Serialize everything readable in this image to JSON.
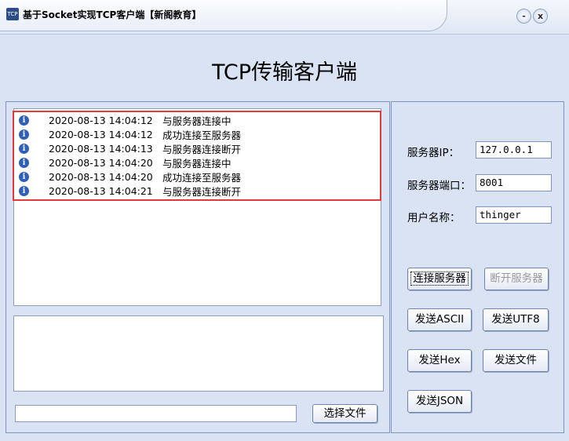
{
  "window": {
    "icon_text": "TCP",
    "title": "基于Socket实现TCP客户端【新阁教育】",
    "minimize": "-",
    "close": "x"
  },
  "heading": "TCP传输客户端",
  "log": [
    {
      "time": "2020-08-13 14:04:12",
      "msg": "与服务器连接中"
    },
    {
      "time": "2020-08-13 14:04:12",
      "msg": "成功连接至服务器"
    },
    {
      "time": "2020-08-13 14:04:13",
      "msg": "与服务器连接断开"
    },
    {
      "time": "2020-08-13 14:04:20",
      "msg": "与服务器连接中"
    },
    {
      "time": "2020-08-13 14:04:20",
      "msg": "成功连接至服务器"
    },
    {
      "time": "2020-08-13 14:04:21",
      "msg": "与服务器连接断开"
    }
  ],
  "send_text": "",
  "file_path": "",
  "choose_file": "选择文件",
  "settings": {
    "ip_label": "服务器IP：",
    "ip": "127.0.0.1",
    "port_label": "服务器端口：",
    "port": "8001",
    "user_label": "用户名称：",
    "user": "thinger"
  },
  "buttons": {
    "connect": "连接服务器",
    "disconnect": "断开服务器",
    "ascii": "发送ASCII",
    "utf8": "发送UTF8",
    "hex": "发送Hex",
    "file": "发送文件",
    "json": "发送JSON"
  }
}
